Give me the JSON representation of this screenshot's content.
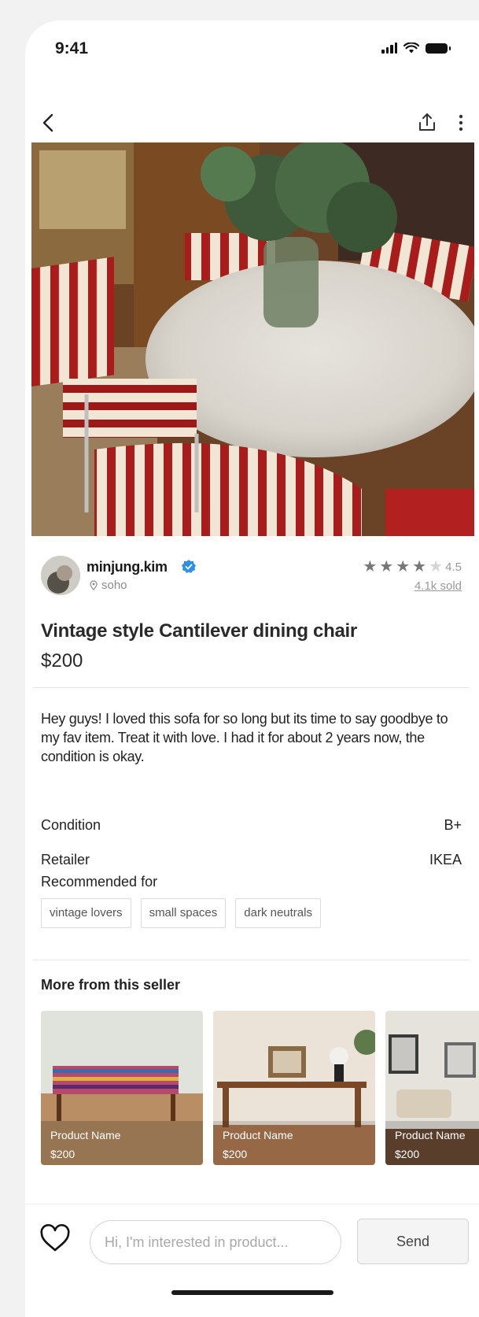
{
  "status_bar": {
    "time": "9:41"
  },
  "seller": {
    "name": "minjung.kim",
    "location": "soho",
    "rating": "4.5",
    "sold": "4.1k sold",
    "stars_filled": 4,
    "stars_total": 5
  },
  "product": {
    "title": "Vintage style Cantilever dining chair",
    "price": "$200",
    "description": "Hey guys! I loved this sofa for so long but its time to say goodbye to my fav item. Treat it with love. I had it for about 2 years now, the condition is okay."
  },
  "specs": [
    {
      "label": "Condition",
      "value": "B+"
    },
    {
      "label": "Retailer",
      "value": "IKEA"
    }
  ],
  "recommended": {
    "label": "Recommended for",
    "tags": [
      "vintage lovers",
      "small spaces",
      "dark neutrals"
    ]
  },
  "more_from_seller": {
    "title": "More from this seller",
    "items": [
      {
        "name": "Product Name",
        "price": "$200"
      },
      {
        "name": "Product Name",
        "price": "$200"
      },
      {
        "name": "Product Name",
        "price": "$200"
      }
    ]
  },
  "bottom_bar": {
    "message_placeholder": "Hi, I'm interested in product...",
    "send_label": "Send"
  },
  "icons": [
    "back-icon",
    "share-icon",
    "more-icon",
    "verified-icon",
    "location-pin-icon",
    "star-icon",
    "heart-icon"
  ]
}
